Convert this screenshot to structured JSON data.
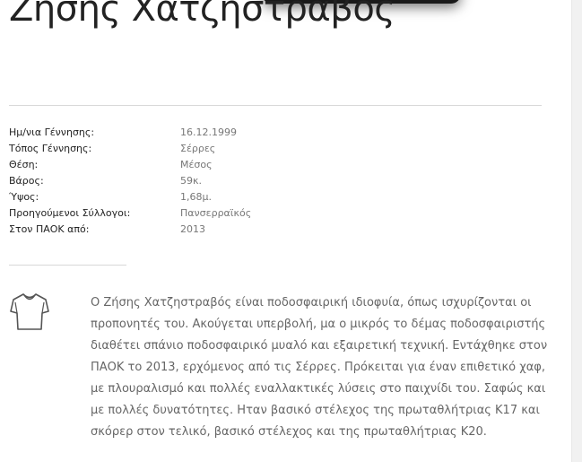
{
  "player": {
    "name": "Ζήσης Χατζηστραβός"
  },
  "info": {
    "rows": [
      {
        "label": "Ημ/νια Γέννησης:",
        "value": "16.12.1999"
      },
      {
        "label": "Τόπος Γέννησης:",
        "value": "Σέρρες"
      },
      {
        "label": "Θέση:",
        "value": "Μέσος"
      },
      {
        "label": "Βάρος:",
        "value": "59κ."
      },
      {
        "label": "Ύψος:",
        "value": "1,68μ."
      },
      {
        "label": "Προηγούμενοι Σύλλογοι:",
        "value": "Πανσερραϊκός"
      },
      {
        "label": "Στον ΠΑΟΚ από:",
        "value": "2013"
      }
    ]
  },
  "bio": {
    "icon": "shirt-icon",
    "text": "Ο Ζήσης Χατζηστραβός είναι ποδοσφαιρική ιδιοφυία, όπως ισχυρίζονται οι προπονητές του. Ακούγεται υπερβολή, μα ο μικρός το δέμας ποδοσφαιριστής διαθέτει σπάνιο ποδοσφαιρικό μυαλό και εξαιρετική τεχνική. Εντάχθηκε στον ΠΑΟΚ το 2013, ερχόμενος από τις Σέρρες. Πρόκειται για έναν επιθετικό χαφ, με πλουραλισμό και πολλές εναλλακτικές λύσεις στο παιχνίδι του. Σαφώς και με πολλές δυνατότητες. Ηταν βασικό στέλεχος της πρωταθλήτριας Κ17 και σκόρερ στον τελικό, βασικό στέλεχος και της πρωταθλήτριας Κ20."
  },
  "colors": {
    "heading": "#222222",
    "label": "#222222",
    "value": "#777777",
    "body_text": "#666666",
    "divider": "#d8d8d8"
  }
}
